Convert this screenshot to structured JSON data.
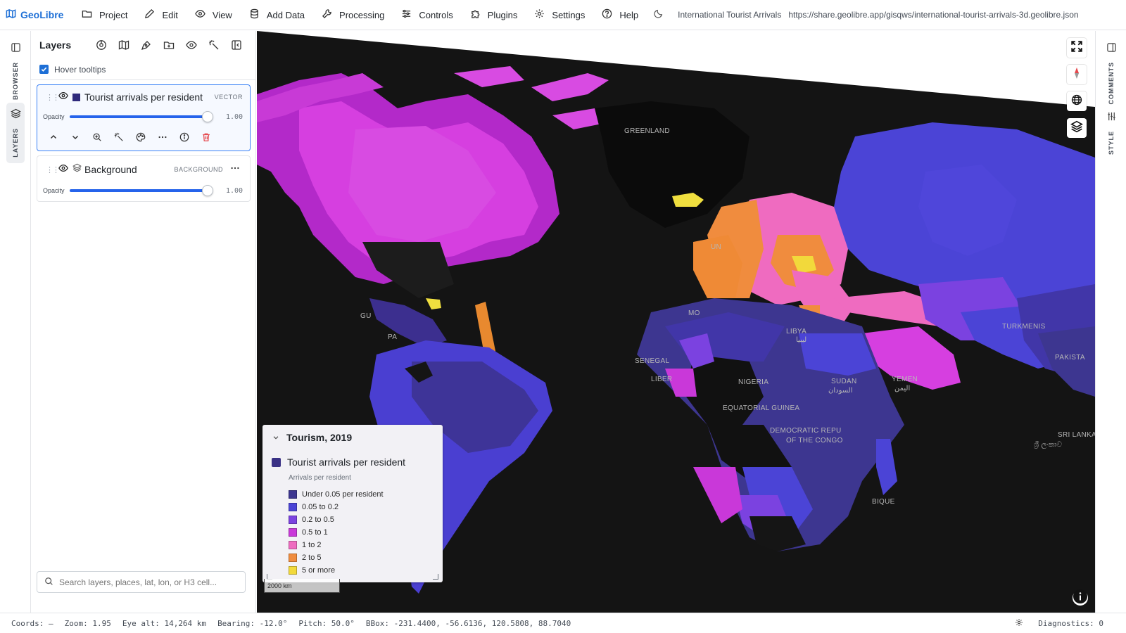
{
  "app": {
    "brand": "GeoLibre"
  },
  "menu": {
    "items": [
      {
        "label": "Project",
        "icon": "folder-icon"
      },
      {
        "label": "Edit",
        "icon": "pencil-icon"
      },
      {
        "label": "View",
        "icon": "eye-icon"
      },
      {
        "label": "Add Data",
        "icon": "database-icon"
      },
      {
        "label": "Processing",
        "icon": "wrench-icon"
      },
      {
        "label": "Controls",
        "icon": "sliders-icon"
      },
      {
        "label": "Plugins",
        "icon": "puzzle-icon"
      },
      {
        "label": "Settings",
        "icon": "gear-icon"
      },
      {
        "label": "Help",
        "icon": "help-icon"
      }
    ],
    "project_title": "International Tourist Arrivals",
    "project_url": "https://share.geolibre.app/gisqws/international-tourist-arrivals-3d.geolibre.json"
  },
  "left_rail": {
    "browser_label": "BROWSER",
    "layers_label": "LAYERS"
  },
  "right_rail": {
    "comments_label": "COMMENTS",
    "style_label": "STYLE"
  },
  "layers_panel": {
    "title": "Layers",
    "hover_tooltips": {
      "label": "Hover tooltips",
      "checked": true
    },
    "layers": [
      {
        "name": "Tourist arrivals per resident",
        "type": "VECTOR",
        "opacity_label": "Opacity",
        "opacity": "1.00",
        "swatch": "#2f2a7c",
        "selected": true
      },
      {
        "name": "Background",
        "type": "BACKGROUND",
        "opacity_label": "Opacity",
        "opacity": "1.00",
        "selected": false
      }
    ],
    "search_placeholder": "Search layers, places, lat, lon, or H3 cell..."
  },
  "map": {
    "labels": {
      "greenland": "GREENLAND",
      "libya": "LIBYA",
      "libya_ar": "ليبيا",
      "sudan": "SUDAN",
      "sudan_ar": "السودان",
      "nigeria": "NIGERIA",
      "senegal": "SENEGAL",
      "liberia": "LIBER",
      "eq_guinea": "EQUATORIAL GUINEA",
      "drc_1": "DEMOCRATIC REPU",
      "drc_2": "OF THE CONGO",
      "yemen": "YEMEN",
      "yemen_ar": "اليمن",
      "turkmenistan": "TURKMENIS",
      "pakistan": "PAKISTA",
      "sri_lanka": "SRI LANKA",
      "sri_lanka_si": "ශ්‍රී ලංකාව",
      "mozambique": "BIQUE",
      "morocco": "MO",
      "guatemala": "GU",
      "panama": "PA",
      "uk": "UN"
    },
    "scalebar": "2000 km"
  },
  "legend": {
    "title": "Tourism, 2019",
    "layer_name": "Tourist arrivals per resident",
    "layer_swatch": "#3a3185",
    "subtitle": "Arrivals per resident",
    "entries": [
      {
        "label": "Under 0.05 per resident",
        "color": "#3d3690"
      },
      {
        "label": "0.05 to 0.2",
        "color": "#4b44d6"
      },
      {
        "label": "0.2 to 0.5",
        "color": "#7b42e0"
      },
      {
        "label": "0.5 to 1",
        "color": "#c938d9"
      },
      {
        "label": "1 to 2",
        "color": "#ee6cc0"
      },
      {
        "label": "2 to 5",
        "color": "#f08c3e"
      },
      {
        "label": "5 or more",
        "color": "#f2d93b"
      }
    ]
  },
  "status": {
    "coords": "Coords: —",
    "zoom": "Zoom: 1.95",
    "eye_alt": "Eye alt: 14,264 km",
    "bearing": "Bearing: -12.0°",
    "pitch": "Pitch: 50.0°",
    "bbox": "BBox: -231.4400, -56.6136, 120.5808, 88.7040",
    "diagnostics": "Diagnostics: 0"
  },
  "colors": {
    "accent": "#1d6fd6",
    "map_bg": "#141414",
    "danger": "#e5484d"
  }
}
